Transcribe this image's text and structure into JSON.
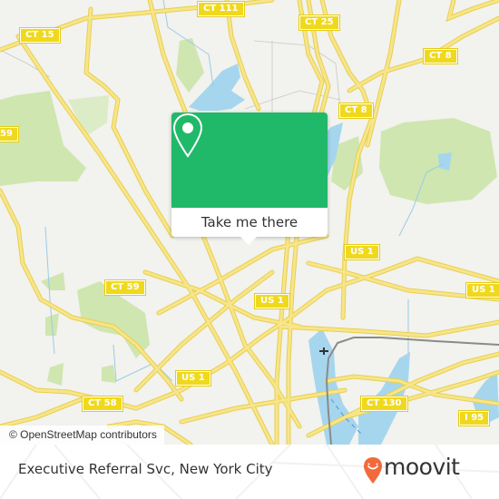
{
  "map": {
    "attribution": "© OpenStreetMap contributors",
    "colors": {
      "land": "#f2f2ee",
      "road": "#f5e27a",
      "road_edge": "#e8cf4e",
      "water": "#a6d6ee",
      "park": "#cfe6b0",
      "rail": "#8a8a8a",
      "shield": "#f0d91c"
    },
    "route_shields": [
      {
        "label": "CT 111"
      },
      {
        "label": "CT 15"
      },
      {
        "label": "CT 25"
      },
      {
        "label": "CT 8"
      },
      {
        "label": "CT 8"
      },
      {
        "label": "59"
      },
      {
        "label": "CT 59"
      },
      {
        "label": "US 1"
      },
      {
        "label": "US 1"
      },
      {
        "label": "US 1"
      },
      {
        "label": "CT 58"
      },
      {
        "label": "US 1"
      },
      {
        "label": "CT 130"
      },
      {
        "label": "I 95"
      }
    ]
  },
  "popup": {
    "button_label": "Take me there",
    "color": "#20b96a",
    "icon": "map-pin-icon"
  },
  "footer": {
    "place_title": "Executive Referral Svc, New York City",
    "brand": "moovit",
    "brand_color": "#f26a3b"
  }
}
